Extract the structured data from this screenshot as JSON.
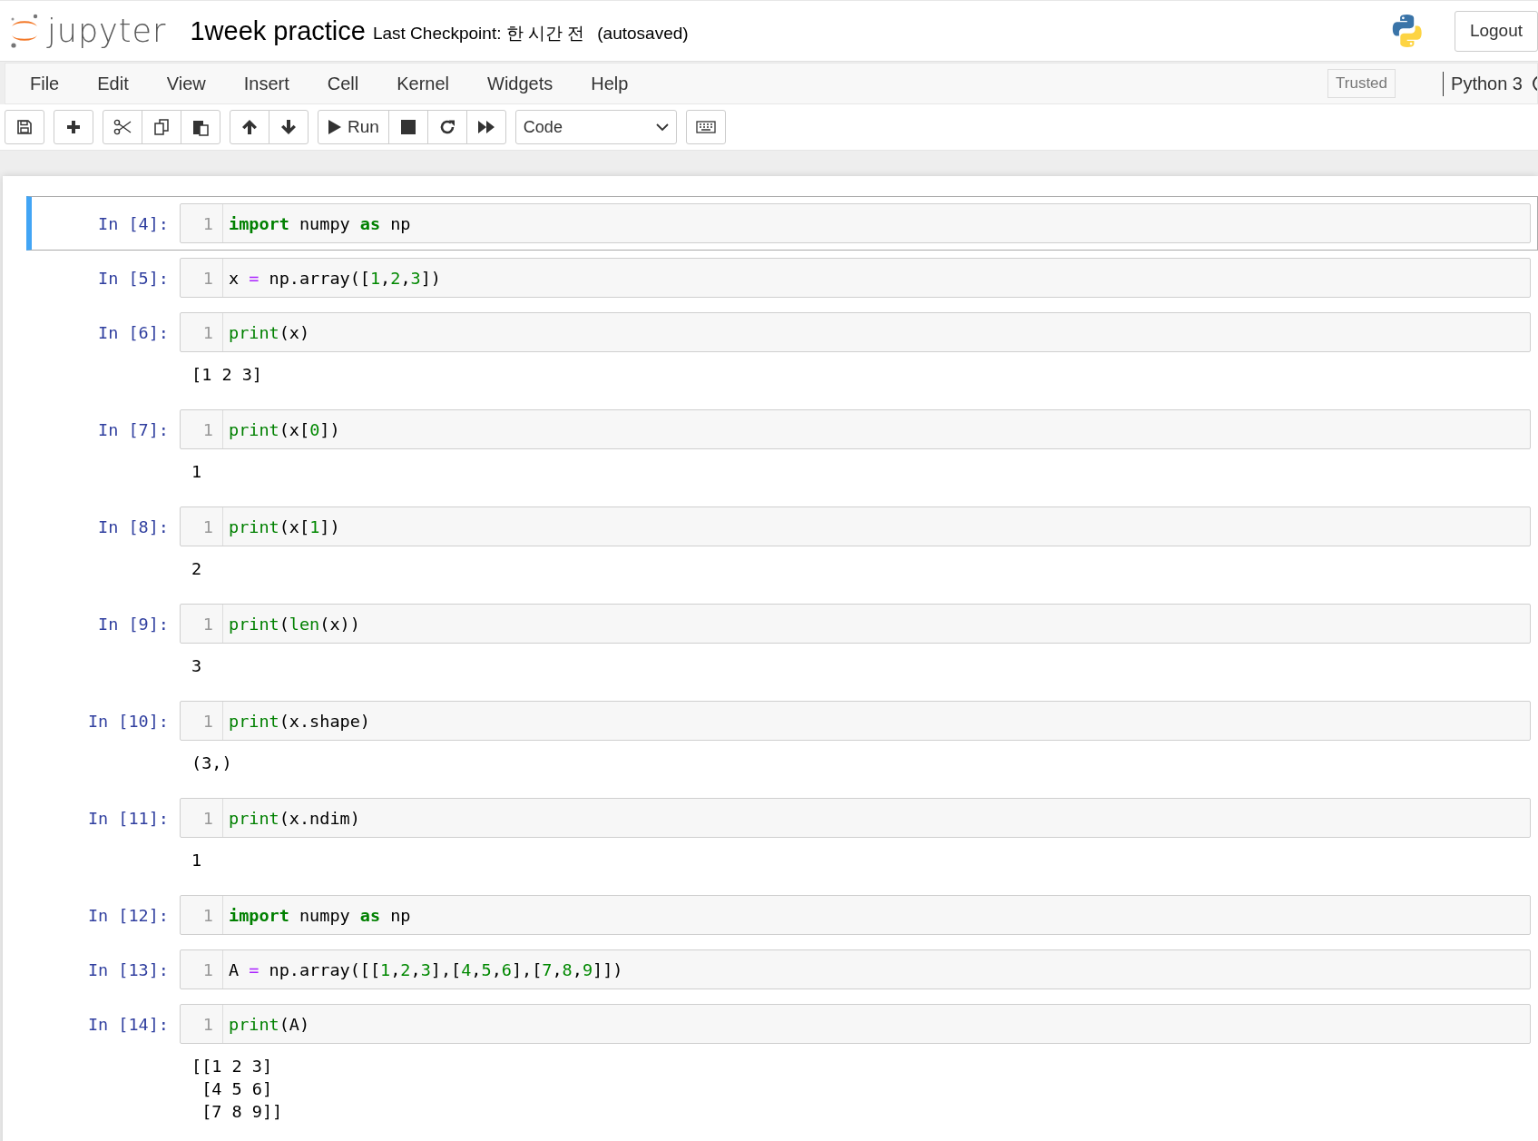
{
  "header": {
    "logo_text": "jupyter",
    "notebook_title": "1week practice",
    "checkpoint": "Last Checkpoint: 한 시간 전",
    "autosave": "(autosaved)",
    "logout": "Logout"
  },
  "menubar": {
    "items": [
      "File",
      "Edit",
      "View",
      "Insert",
      "Cell",
      "Kernel",
      "Widgets",
      "Help"
    ],
    "trusted": "Trusted",
    "kernel_name": "Python 3"
  },
  "toolbar": {
    "run_label": "Run",
    "cell_type": "Code"
  },
  "cells": [
    {
      "prompt": "In [4]:",
      "selected": true,
      "line_number": "1",
      "code": [
        {
          "text": "import",
          "kind": "keyword"
        },
        {
          "text": " numpy ",
          "kind": "plain"
        },
        {
          "text": "as",
          "kind": "keyword"
        },
        {
          "text": " np",
          "kind": "plain"
        }
      ]
    },
    {
      "prompt": "In [5]:",
      "selected": false,
      "line_number": "1",
      "code": [
        {
          "text": "x ",
          "kind": "plain"
        },
        {
          "text": "=",
          "kind": "operator"
        },
        {
          "text": " np.array([",
          "kind": "plain"
        },
        {
          "text": "1",
          "kind": "number"
        },
        {
          "text": ",",
          "kind": "plain"
        },
        {
          "text": "2",
          "kind": "number"
        },
        {
          "text": ",",
          "kind": "plain"
        },
        {
          "text": "3",
          "kind": "number"
        },
        {
          "text": "])",
          "kind": "plain"
        }
      ]
    },
    {
      "prompt": "In [6]:",
      "selected": false,
      "line_number": "1",
      "code": [
        {
          "text": "print",
          "kind": "builtin"
        },
        {
          "text": "(x)",
          "kind": "plain"
        }
      ],
      "output": "[1 2 3]"
    },
    {
      "prompt": "In [7]:",
      "selected": false,
      "line_number": "1",
      "code": [
        {
          "text": "print",
          "kind": "builtin"
        },
        {
          "text": "(x[",
          "kind": "plain"
        },
        {
          "text": "0",
          "kind": "number"
        },
        {
          "text": "])",
          "kind": "plain"
        }
      ],
      "output": "1"
    },
    {
      "prompt": "In [8]:",
      "selected": false,
      "line_number": "1",
      "code": [
        {
          "text": "print",
          "kind": "builtin"
        },
        {
          "text": "(x[",
          "kind": "plain"
        },
        {
          "text": "1",
          "kind": "number"
        },
        {
          "text": "])",
          "kind": "plain"
        }
      ],
      "output": "2"
    },
    {
      "prompt": "In [9]:",
      "selected": false,
      "line_number": "1",
      "code": [
        {
          "text": "print",
          "kind": "builtin"
        },
        {
          "text": "(",
          "kind": "plain"
        },
        {
          "text": "len",
          "kind": "builtin"
        },
        {
          "text": "(x))",
          "kind": "plain"
        }
      ],
      "output": "3"
    },
    {
      "prompt": "In [10]:",
      "selected": false,
      "line_number": "1",
      "code": [
        {
          "text": "print",
          "kind": "builtin"
        },
        {
          "text": "(x.shape)",
          "kind": "plain"
        }
      ],
      "output": "(3,)"
    },
    {
      "prompt": "In [11]:",
      "selected": false,
      "line_number": "1",
      "code": [
        {
          "text": "print",
          "kind": "builtin"
        },
        {
          "text": "(x.ndim)",
          "kind": "plain"
        }
      ],
      "output": "1"
    },
    {
      "prompt": "In [12]:",
      "selected": false,
      "line_number": "1",
      "code": [
        {
          "text": "import",
          "kind": "keyword"
        },
        {
          "text": " numpy ",
          "kind": "plain"
        },
        {
          "text": "as",
          "kind": "keyword"
        },
        {
          "text": " np",
          "kind": "plain"
        }
      ]
    },
    {
      "prompt": "In [13]:",
      "selected": false,
      "line_number": "1",
      "code": [
        {
          "text": "A ",
          "kind": "plain"
        },
        {
          "text": "=",
          "kind": "operator"
        },
        {
          "text": " np.array([[",
          "kind": "plain"
        },
        {
          "text": "1",
          "kind": "number"
        },
        {
          "text": ",",
          "kind": "plain"
        },
        {
          "text": "2",
          "kind": "number"
        },
        {
          "text": ",",
          "kind": "plain"
        },
        {
          "text": "3",
          "kind": "number"
        },
        {
          "text": "],[",
          "kind": "plain"
        },
        {
          "text": "4",
          "kind": "number"
        },
        {
          "text": ",",
          "kind": "plain"
        },
        {
          "text": "5",
          "kind": "number"
        },
        {
          "text": ",",
          "kind": "plain"
        },
        {
          "text": "6",
          "kind": "number"
        },
        {
          "text": "],[",
          "kind": "plain"
        },
        {
          "text": "7",
          "kind": "number"
        },
        {
          "text": ",",
          "kind": "plain"
        },
        {
          "text": "8",
          "kind": "number"
        },
        {
          "text": ",",
          "kind": "plain"
        },
        {
          "text": "9",
          "kind": "number"
        },
        {
          "text": "]])",
          "kind": "plain"
        }
      ]
    },
    {
      "prompt": "In [14]:",
      "selected": false,
      "line_number": "1",
      "code": [
        {
          "text": "print",
          "kind": "builtin"
        },
        {
          "text": "(A)",
          "kind": "plain"
        }
      ],
      "output": "[[1 2 3]\n [4 5 6]\n [7 8 9]]"
    }
  ]
}
